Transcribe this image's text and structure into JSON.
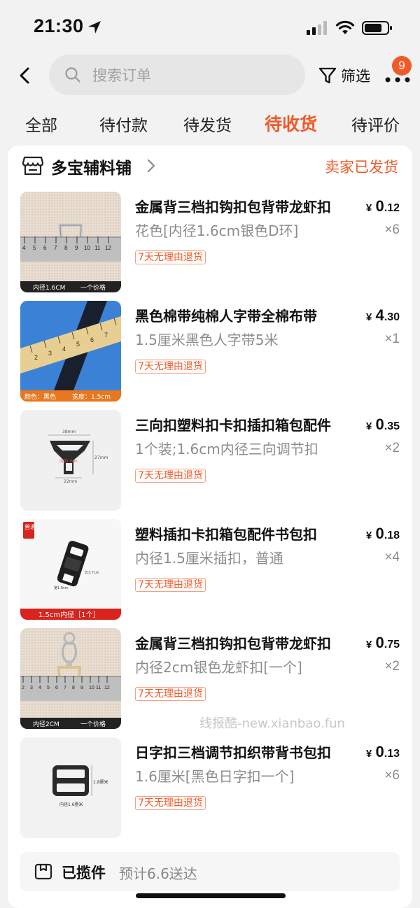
{
  "status_bar": {
    "time": "21:30"
  },
  "header": {
    "search_placeholder": "搜索订单",
    "filter_label": "筛选",
    "more_badge": "9"
  },
  "tabs": [
    {
      "label": "全部"
    },
    {
      "label": "待付款"
    },
    {
      "label": "待发货"
    },
    {
      "label": "待收货"
    },
    {
      "label": "待评价"
    }
  ],
  "order": {
    "shop_name": "多宝辅料铺",
    "status": "卖家已发货",
    "items": [
      {
        "title": "金属背三档扣钩扣包背带龙虾扣",
        "spec": "花色[内径1.6cm银色D环]",
        "price_cur": "¥",
        "price_int": "0",
        "price_dec": ".12",
        "qty": "×6",
        "tag": "7天无理由退货",
        "thumb": {
          "ruler_nums": [
            "4",
            "5",
            "6",
            "7",
            "8",
            "9",
            "10",
            "11",
            "12"
          ],
          "caption_left": "内径1.6CM",
          "caption_right": "一个价格"
        }
      },
      {
        "title": "黑色棉带纯棉人字带全棉布带",
        "spec": "1.5厘米黑色人字带5米",
        "price_cur": "¥",
        "price_int": "4",
        "price_dec": ".30",
        "qty": "×1",
        "tag": "7天无理由退货",
        "thumb": {
          "ruler_nums": [
            "2",
            "3",
            "4",
            "5",
            "6",
            "7"
          ],
          "caption_left": "颜色：黑色",
          "caption_right": "宽度：1.5cm"
        }
      },
      {
        "title": "三向扣塑料扣卡扣插扣箱包配件",
        "spec": "1个装;1.6cm内径三向调节扣",
        "price_cur": "¥",
        "price_int": "0",
        "price_dec": ".35",
        "qty": "×2",
        "tag": "7天无理由退货",
        "thumb": {
          "dim_top": "38mm",
          "dim_right": "27mm",
          "dim_bottom": "22mm",
          "dim_inner": "内径1.6cm"
        }
      },
      {
        "title": "塑料插扣卡扣箱包配件书包扣",
        "spec": "内径1.5厘米插扣，普通",
        "price_cur": "¥",
        "price_int": "0",
        "price_dec": ".18",
        "qty": "×4",
        "tag": "7天无理由退货",
        "thumb": {
          "corner_label": "普通",
          "dim_side": "长3.7cm",
          "dim_bottom": "宽1.9cm",
          "caption": "1.5cm内径［1个］"
        }
      },
      {
        "title": "金属背三档扣钩扣包背带龙虾扣",
        "spec": "内径2cm银色龙虾扣[一个]",
        "price_cur": "¥",
        "price_int": "0",
        "price_dec": ".75",
        "qty": "×2",
        "tag": "7天无理由退货",
        "thumb": {
          "ruler_nums": [
            "2",
            "3",
            "4",
            "5",
            "6",
            "7",
            "8",
            "9",
            "10",
            "11",
            "12"
          ],
          "caption_left": "内径2CM",
          "caption_right": "一个价格"
        }
      },
      {
        "title": "日字扣三档调节扣织带背书包扣",
        "spec": "1.6厘米[黑色日字扣一个]",
        "price_cur": "¥",
        "price_int": "0",
        "price_dec": ".13",
        "qty": "×6",
        "tag": "7天无理由退货",
        "thumb": {
          "dim_right": "1.8厘米",
          "dim_bottom": "内径1.6厘米"
        }
      }
    ],
    "logistics": {
      "status": "已揽件",
      "eta": "预计6.6送达"
    }
  },
  "watermark": "线报酷-new.xianbao.fun",
  "colors": {
    "accent": "#f05a28",
    "muted": "#8c8c8c",
    "background": "#f2f2f2"
  }
}
